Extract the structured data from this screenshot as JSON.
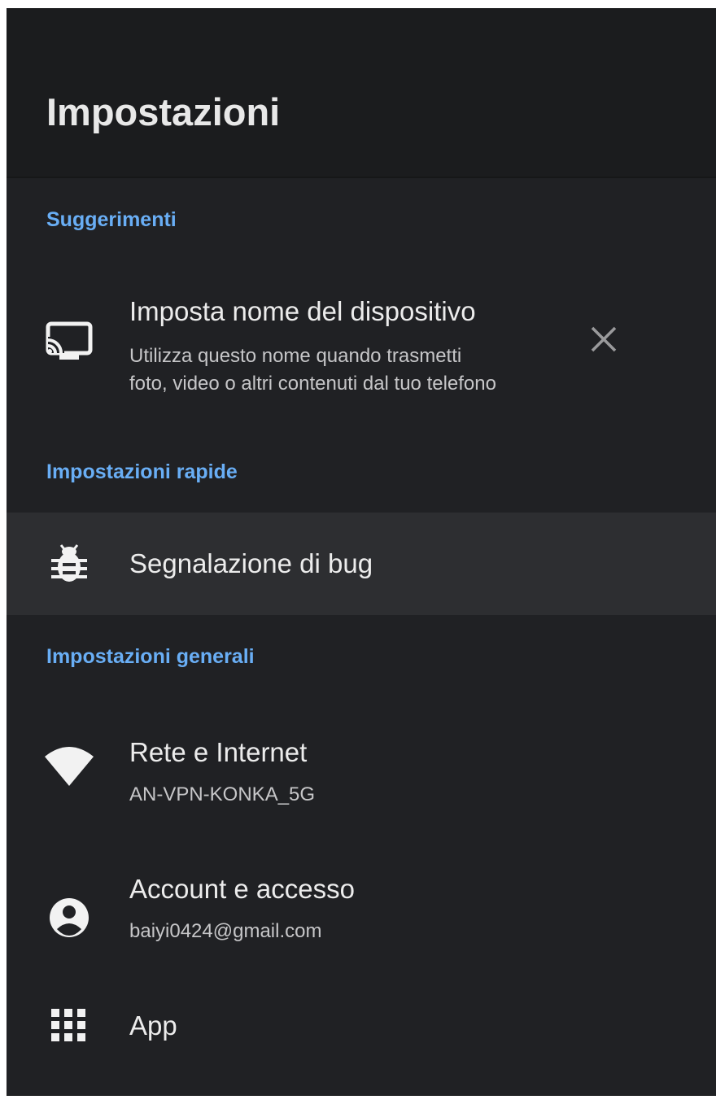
{
  "header": {
    "title": "Impostazioni"
  },
  "sections": {
    "suggestions": {
      "title": "Suggerimenti",
      "items": [
        {
          "icon": "cast-icon",
          "title": "Imposta nome del dispositivo",
          "subtitle_line1": "Utilizza questo nome quando trasmetti",
          "subtitle_line2": "foto, video o altri contenuti dal tuo telefono",
          "dismiss_icon": "close-icon"
        }
      ]
    },
    "quick": {
      "title": "Impostazioni rapide",
      "items": [
        {
          "icon": "bug-icon",
          "title": "Segnalazione di bug",
          "focused": true
        }
      ]
    },
    "general": {
      "title": "Impostazioni generali",
      "items": [
        {
          "icon": "wifi-icon",
          "title": "Rete e Internet",
          "subtitle": "AN-VPN-KONKA_5G"
        },
        {
          "icon": "account-icon",
          "title": "Account e accesso",
          "subtitle": "baiyi0424@gmail.com"
        },
        {
          "icon": "apps-grid-icon",
          "title": "App"
        }
      ]
    }
  },
  "colors": {
    "background": "#202124",
    "header_background": "#1b1c1e",
    "accent": "#69aef5",
    "focused_row": "#2d2e31",
    "text_primary": "#ececec",
    "text_secondary": "#c6c6c8"
  }
}
